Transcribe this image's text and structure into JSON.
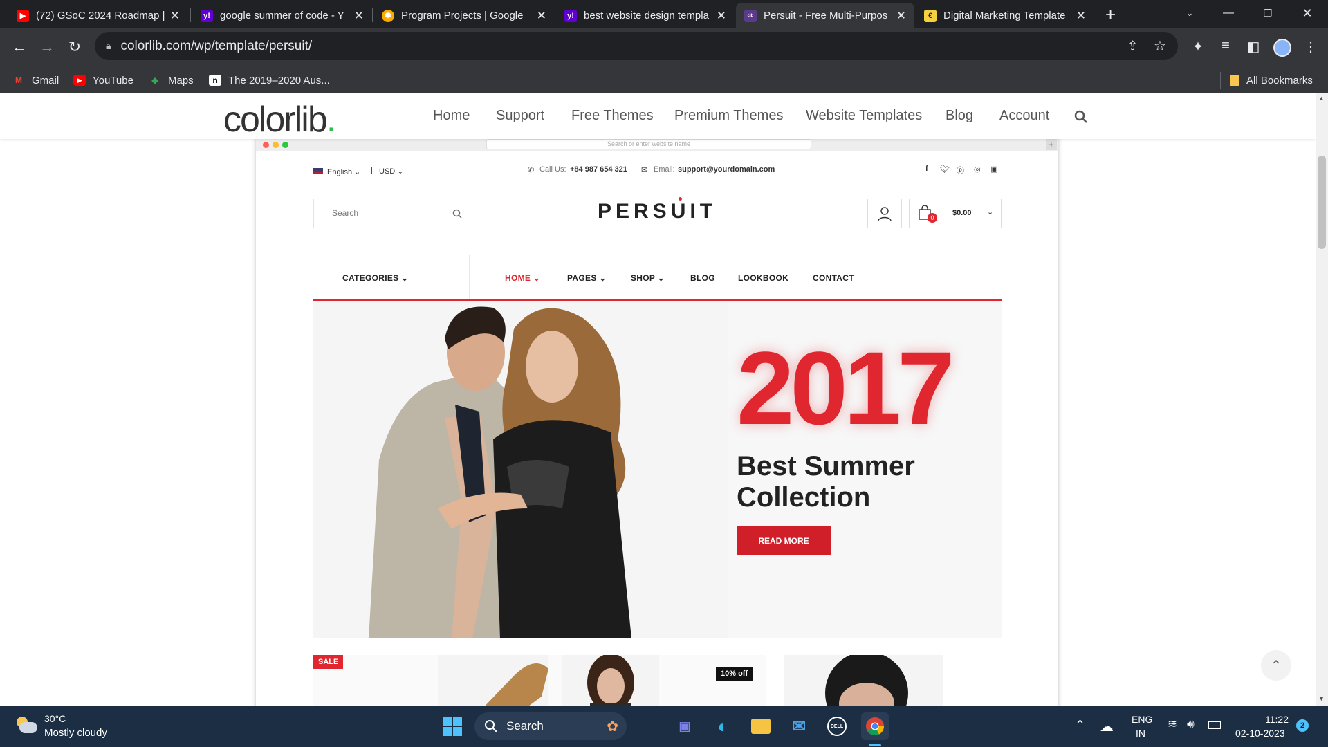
{
  "browser": {
    "tabs": [
      {
        "title": "(72) GSoC 2024 Roadmap |",
        "icon": "youtube-icon",
        "active": false
      },
      {
        "title": "google summer of code - Y",
        "icon": "yahoo-icon",
        "active": false
      },
      {
        "title": "Program Projects | Google",
        "icon": "gsoc-icon",
        "active": false
      },
      {
        "title": "best website design templa",
        "icon": "yahoo-icon",
        "active": false
      },
      {
        "title": "Persuit - Free Multi-Purpos",
        "icon": "colorlib-icon",
        "active": true
      },
      {
        "title": "Digital Marketing Template",
        "icon": "template-icon",
        "active": false
      }
    ],
    "url": "colorlib.com/wp/template/persuit/",
    "bookmarks": [
      {
        "label": "Gmail",
        "icon": "gmail-icon"
      },
      {
        "label": "YouTube",
        "icon": "youtube-icon"
      },
      {
        "label": "Maps",
        "icon": "maps-icon"
      },
      {
        "label": "The 2019–2020 Aus...",
        "icon": "notion-icon"
      }
    ],
    "all_bookmarks": "All Bookmarks"
  },
  "colorlib": {
    "logo": "colorlib",
    "logo_dot": ".",
    "nav": [
      "Home",
      "Support",
      "Free Themes",
      "Premium Themes",
      "Website Templates",
      "Blog",
      "Account"
    ]
  },
  "mockup": {
    "address_placeholder": "Search or enter website name"
  },
  "persuit": {
    "language": "English",
    "currency": "USD",
    "call_label": "Call Us:",
    "phone": "+84 987 654 321",
    "email_label": "Email:",
    "email": "support@yourdomain.com",
    "search_placeholder": "Search",
    "logo": "PERSUIT",
    "cart_count": "0",
    "cart_total": "$0.00",
    "categories_label": "CATEGORIES",
    "menu": [
      "HOME",
      "PAGES",
      "SHOP",
      "BLOG",
      "LOOKBOOK",
      "CONTACT"
    ],
    "hero": {
      "year": "2017",
      "title": "Best Summer Collection",
      "button": "READ MORE"
    },
    "badges": {
      "sale": "SALE",
      "discount": "10% off"
    }
  },
  "taskbar": {
    "weather_temp": "30°C",
    "weather_desc": "Mostly cloudy",
    "search_label": "Search",
    "lang_top": "ENG",
    "lang_bottom": "IN",
    "time": "11:22",
    "date": "02-10-2023",
    "notifications": "2"
  }
}
